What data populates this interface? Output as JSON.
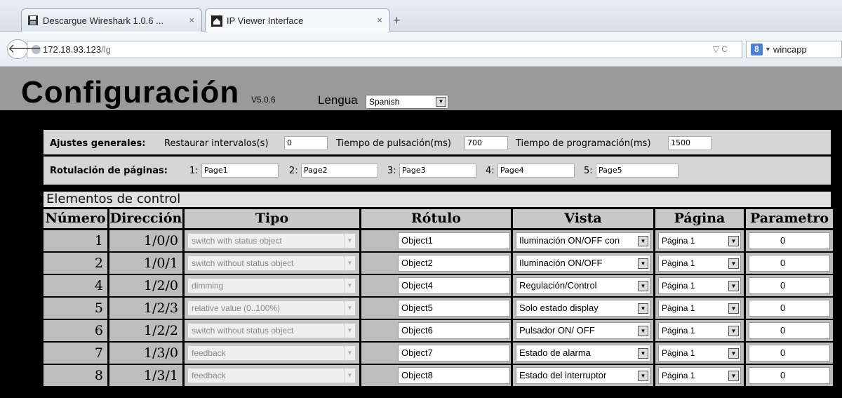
{
  "browser": {
    "tabs": [
      {
        "label": "Descargue Wireshark 1.0.6 ...",
        "close": "×"
      },
      {
        "label": "IP Viewer Interface",
        "close": "×"
      }
    ],
    "new_tab": "+",
    "url_host": "172.18.93.123",
    "url_path": "/lg",
    "url_right": "▽ C",
    "search_text": "wincapp",
    "search_engine": "8"
  },
  "header": {
    "title": "Configuración",
    "version": "V5.0.6",
    "lang_label": "Lengua",
    "lang_value": "Spanish"
  },
  "general": {
    "label": "Ajustes generales:",
    "restore_label": "Restaurar intervalos(s)",
    "restore_value": "0",
    "press_label": "Tiempo de pulsación(ms)",
    "press_value": "700",
    "prog_label": "Tiempo de programación(ms)",
    "prog_value": "1500"
  },
  "pages": {
    "label": "Rotulación de páginas:",
    "items": [
      {
        "n": "1:",
        "v": "Page1"
      },
      {
        "n": "2:",
        "v": "Page2"
      },
      {
        "n": "3:",
        "v": "Page3"
      },
      {
        "n": "4:",
        "v": "Page4"
      },
      {
        "n": "5:",
        "v": "Page5"
      }
    ]
  },
  "section_title": "Elementos de control",
  "table": {
    "headers": [
      "Número",
      "Dirección",
      "Tipo",
      "Rótulo",
      "Vista",
      "Página",
      "Parametro"
    ],
    "rows": [
      {
        "num": "1",
        "dir": "1/0/0",
        "tipo": "switch with status object",
        "rotulo": "Object1",
        "vista": "Iluminación ON/OFF con",
        "pagina": "Página 1",
        "param": "0"
      },
      {
        "num": "2",
        "dir": "1/0/1",
        "tipo": "switch without status object",
        "rotulo": "Object2",
        "vista": "Iluminación ON/OFF",
        "pagina": "Página 1",
        "param": "0"
      },
      {
        "num": "4",
        "dir": "1/2/0",
        "tipo": "dimming",
        "rotulo": "Object4",
        "vista": "Regulación/Control",
        "pagina": "Página 1",
        "param": "0"
      },
      {
        "num": "5",
        "dir": "1/2/3",
        "tipo": "relative value (0..100%)",
        "rotulo": "Object5",
        "vista": "Solo estado display",
        "pagina": "Página 1",
        "param": "0"
      },
      {
        "num": "6",
        "dir": "1/2/2",
        "tipo": "switch without status object",
        "rotulo": "Object6",
        "vista": "Pulsador ON/ OFF",
        "pagina": "Página 1",
        "param": "0"
      },
      {
        "num": "7",
        "dir": "1/3/0",
        "tipo": "feedback",
        "rotulo": "Object7",
        "vista": "Estado de alarma",
        "pagina": "Página 1",
        "param": "0"
      },
      {
        "num": "8",
        "dir": "1/3/1",
        "tipo": "feedback",
        "rotulo": "Object8",
        "vista": "Estado del interruptor",
        "pagina": "Página 1",
        "param": "0"
      }
    ]
  }
}
